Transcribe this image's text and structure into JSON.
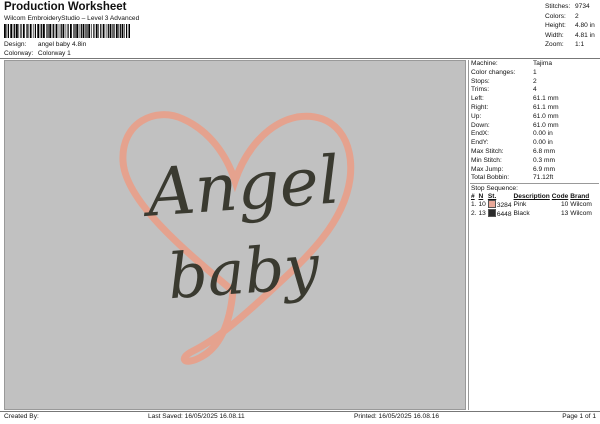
{
  "header": {
    "title": "Production Worksheet",
    "subtitle": "Wilcom EmbroideryStudio – Level 3 Advanced",
    "design_label": "Design:",
    "design_value": "angel baby 4.8in",
    "colorway_label": "Colorway:",
    "colorway_value": "Colorway 1"
  },
  "summary": [
    {
      "label": "Stitches:",
      "value": "9734"
    },
    {
      "label": "Colors:",
      "value": "2"
    },
    {
      "label": "Height:",
      "value": "4.80 in"
    },
    {
      "label": "Width:",
      "value": "4.81 in"
    },
    {
      "label": "Zoom:",
      "value": "1:1"
    }
  ],
  "machine": [
    {
      "label": "Machine:",
      "value": "Tajima"
    },
    {
      "label": "Color changes:",
      "value": "1"
    },
    {
      "label": "Stops:",
      "value": "2"
    },
    {
      "label": "Trims:",
      "value": "4"
    },
    {
      "label": "Left:",
      "value": "61.1 mm"
    },
    {
      "label": "Right:",
      "value": "61.1 mm"
    },
    {
      "label": "Up:",
      "value": "61.0 mm"
    },
    {
      "label": "Down:",
      "value": "61.0 mm"
    },
    {
      "label": "EndX:",
      "value": "0.00 in"
    },
    {
      "label": "EndY:",
      "value": "0.00 in"
    },
    {
      "label": "Max Stitch:",
      "value": "6.8 mm"
    },
    {
      "label": "Min Stitch:",
      "value": "0.3 mm"
    },
    {
      "label": "Max Jump:",
      "value": "6.9 mm"
    },
    {
      "label": "Total Bobbin:",
      "value": "71.12ft"
    }
  ],
  "stops": {
    "title": "Stop Sequence:",
    "headers": [
      "#",
      "N",
      "St.",
      "Description",
      "Code",
      "Brand"
    ],
    "rows": [
      {
        "num": "1.",
        "n": "10",
        "color": "#e8a898",
        "st": "3284",
        "desc": "Pink",
        "code": "10",
        "brand": "Wilcom"
      },
      {
        "num": "2.",
        "n": "13",
        "color": "#2a2a2a",
        "st": "6448",
        "desc": "Black",
        "code": "13",
        "brand": "Wilcom"
      }
    ]
  },
  "design": {
    "line1": "Angel",
    "line2": "baby",
    "heart_color": "#e5a28e",
    "text_color": "#3a3a30",
    "background": "#c1c1c1"
  },
  "footer": {
    "created_by": "Created By:",
    "last_saved": "Last Saved: 16/05/2025 16.08.11",
    "printed": "Printed: 16/05/2025 16.08.16",
    "page": "Page 1 of 1"
  }
}
